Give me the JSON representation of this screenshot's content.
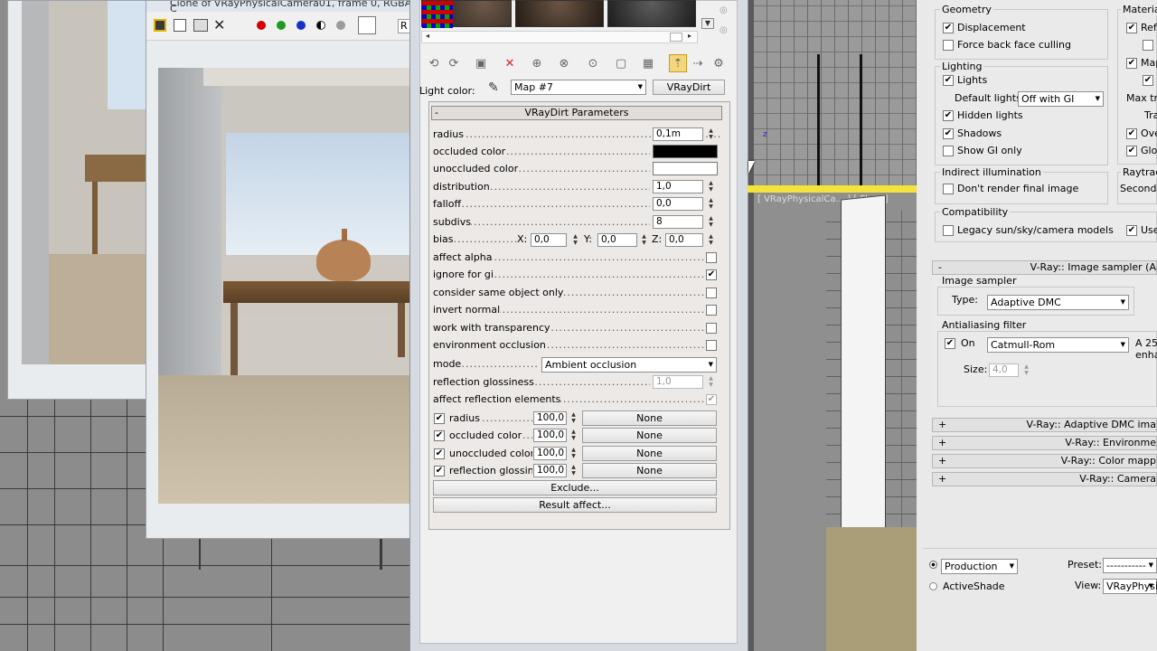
{
  "render_window": {
    "title": "Clone of VRayPhysicalCamera01, frame 0, RGBA C",
    "channel_label": "R"
  },
  "material_editor": {
    "light_color_label": "Light color:",
    "map_dropdown": "Map #7",
    "map_type_button": "VRayDirt",
    "rollout_title": "VRayDirt Parameters",
    "params": {
      "radius_label": "radius",
      "radius_value": "0,1m",
      "occluded_color_label": "occluded color",
      "occluded_color": "#000000",
      "unoccluded_color_label": "unoccluded color",
      "unoccluded_color": "#ffffff",
      "distribution_label": "distribution",
      "distribution_value": "1,0",
      "falloff_label": "falloff",
      "falloff_value": "0,0",
      "subdivs_label": "subdivs",
      "subdivs_value": "8",
      "bias_label": "bias",
      "bias_x_label": "X:",
      "bias_x": "0,0",
      "bias_y_label": "Y:",
      "bias_y": "0,0",
      "bias_z_label": "Z:",
      "bias_z": "0,0",
      "affect_alpha": "affect alpha",
      "ignore_for_gi": "ignore for gi",
      "consider_same_object_only": "consider same object only",
      "invert_normal": "invert normal",
      "work_with_transparency": "work with transparency",
      "environment_occlusion": "environment occlusion",
      "mode_label": "mode",
      "mode_value": "Ambient occlusion",
      "reflection_glossiness_label": "reflection glossiness",
      "reflection_glossiness_value": "1,0",
      "affect_reflection_elements": "affect reflection elements"
    },
    "maps": [
      {
        "label": "radius",
        "value": "100,0",
        "map": "None"
      },
      {
        "label": "occluded color",
        "value": "100,0",
        "map": "None"
      },
      {
        "label": "unoccluded color",
        "value": "100,0",
        "map": "None"
      },
      {
        "label": "reflection glossines",
        "value": "100,0",
        "map": "None"
      }
    ],
    "exclude_button": "Exclude...",
    "result_affect_button": "Result affect..."
  },
  "render_setup": {
    "geometry": {
      "title": "Geometry",
      "displacement": "Displacement",
      "force_back_face_culling": "Force back face culling"
    },
    "materials_title": "Materia",
    "materials_refl": "Ref",
    "materials_map": "Map",
    "materials_max_tr": "Max tra",
    "materials_tra": "Tra",
    "materials_ove": "Ove",
    "materials_glo": "Glo",
    "lighting": {
      "title": "Lighting",
      "lights": "Lights",
      "default_lights_label": "Default lights",
      "default_lights_value": "Off with GI",
      "hidden_lights": "Hidden lights",
      "shadows": "Shadows",
      "show_gi_only": "Show GI only"
    },
    "indirect": {
      "title": "Indirect illumination",
      "dont_render_final": "Don't render final image"
    },
    "raytrace_title": "Raytrac",
    "raytrace_secondary": "Seconda",
    "compatibility": {
      "title": "Compatibility",
      "legacy": "Legacy sun/sky/camera models",
      "use": "Use"
    },
    "image_sampler_bar": "V-Ray:: Image sampler (A",
    "image_sampler": {
      "title": "Image sampler",
      "type_label": "Type:",
      "type_value": "Adaptive DMC"
    },
    "aa_filter": {
      "title": "Antialiasing filter",
      "on_label": "On",
      "filter_value": "Catmull-Rom",
      "desc1": "A 25",
      "desc2": "enha",
      "size_label": "Size:",
      "size_value": "4,0"
    },
    "collapsed_bars": [
      "V-Ray:: Adaptive DMC ima",
      "V-Ray:: Environme",
      "V-Ray:: Color mapp",
      "V-Ray:: Camera"
    ],
    "production_label": "Production",
    "activeshade_label": "ActiveShade",
    "preset_label": "Preset:",
    "preset_value": "-----------",
    "view_label": "View:",
    "view_value": "VRayPhysica"
  },
  "viewport_label": "[ VRayPhysicalCa... ] [ Fla... ]"
}
